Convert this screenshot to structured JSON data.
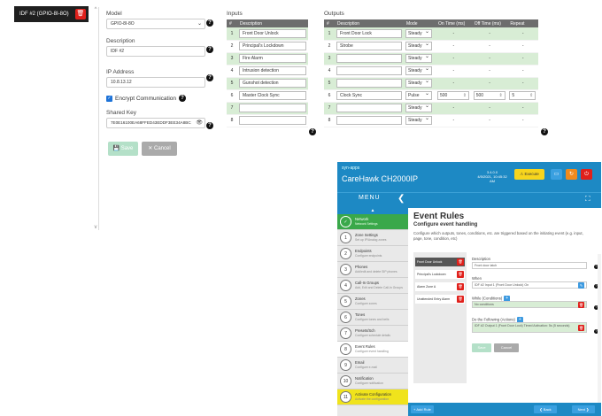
{
  "device_list": {
    "selected": "IDF #2 (GPIO-8I-8O)"
  },
  "form": {
    "model_label": "Model",
    "model_value": "GPIO-8I-8O",
    "description_label": "Description",
    "description_value": "IDF #2",
    "ip_label": "IP Address",
    "ip_value": "10.8.13.12",
    "encrypt_label": "Encrypt Communication",
    "shared_key_label": "Shared Key",
    "shared_key_value": "7E0E16100EA68FFED43EDDF3EE34A8BC",
    "save_label": "Save",
    "cancel_label": "Cancel"
  },
  "inputs": {
    "title": "Inputs",
    "headers": [
      "#",
      "Description"
    ],
    "rows": [
      {
        "n": "1",
        "d": "Front Door Unlock"
      },
      {
        "n": "2",
        "d": "Principal's Lockdown"
      },
      {
        "n": "3",
        "d": "Fire Alarm"
      },
      {
        "n": "4",
        "d": "Intrusion detection"
      },
      {
        "n": "5",
        "d": "Gunshot detection"
      },
      {
        "n": "6",
        "d": "Master Clock Sync"
      },
      {
        "n": "7",
        "d": ""
      },
      {
        "n": "8",
        "d": ""
      }
    ]
  },
  "outputs": {
    "title": "Outputs",
    "headers": [
      "#",
      "Description",
      "Mode",
      "On Time (ms)",
      "Off Time (ms)",
      "Repeat"
    ],
    "rows": [
      {
        "n": "1",
        "d": "Front Door Lock",
        "m": "Steady",
        "on": "-",
        "off": "-",
        "r": "-"
      },
      {
        "n": "2",
        "d": "Strobe",
        "m": "Steady",
        "on": "-",
        "off": "-",
        "r": "-"
      },
      {
        "n": "3",
        "d": "",
        "m": "Steady",
        "on": "-",
        "off": "-",
        "r": "-"
      },
      {
        "n": "4",
        "d": "",
        "m": "Steady",
        "on": "-",
        "off": "-",
        "r": "-"
      },
      {
        "n": "5",
        "d": "",
        "m": "Steady",
        "on": "-",
        "off": "-",
        "r": "-"
      },
      {
        "n": "6",
        "d": "Clock Sync",
        "m": "Pulse",
        "on": "500",
        "off": "500",
        "r": "5"
      },
      {
        "n": "7",
        "d": "",
        "m": "Steady",
        "on": "-",
        "off": "-",
        "r": "-"
      },
      {
        "n": "8",
        "d": "",
        "m": "Steady",
        "on": "-",
        "off": "-",
        "r": "-"
      }
    ]
  },
  "app": {
    "logo_text": "syn-apps",
    "product_name": "CareHawk CH2000IP",
    "version": "3.4.0.0",
    "datetime": "4/5/2021, 10:45:32 AM",
    "alarm_label": "Execute",
    "menu_label": "MENU",
    "side_items": [
      {
        "n": "✓",
        "t": "Network",
        "s": "Network Settings"
      },
      {
        "n": "1",
        "t": "Zone Settings",
        "s": "Set up IP/Analog zones"
      },
      {
        "n": "2",
        "t": "Endpoints",
        "s": "Configure endpoints"
      },
      {
        "n": "3",
        "t": "Phones",
        "s": "Add/edit and delete SIP phones"
      },
      {
        "n": "4",
        "t": "Call-In Groups",
        "s": "Add, Edit and Delete Call-In Groups"
      },
      {
        "n": "5",
        "t": "Zones",
        "s": "Configure zones"
      },
      {
        "n": "6",
        "t": "Tones",
        "s": "Configure tones and bells"
      },
      {
        "n": "7",
        "t": "Presets/Sch",
        "s": "Configure schedule details"
      },
      {
        "n": "8",
        "t": "Event Rules",
        "s": "Configure event handling"
      },
      {
        "n": "9",
        "t": "Email",
        "s": "Configure e-mail"
      },
      {
        "n": "10",
        "t": "Notification",
        "s": "Configure notification"
      },
      {
        "n": "11",
        "t": "Activate Configuration",
        "s": "Activate the configuration"
      }
    ],
    "title": "Event Rules",
    "subtitle": "Configure event handling",
    "desc": "Configure which outputs, tones, conditions, etc. are triggered based on the initiating event (e.g. input, page, tone, condition, etc)",
    "rules": [
      "Front Door Unlock",
      "Principal's Lockdown",
      "Alarm Zone A",
      "Unattended Entry Alarm"
    ],
    "rule_form": {
      "description_label": "Description",
      "description_value": "Front door latch",
      "when_label": "When",
      "when_value": "IDF #2 Input 1 (Front Door Unlock) On",
      "while_label": "While (Conditions)",
      "while_value": "No conditions",
      "do_label": "Do the Following (Actions)",
      "do_value": "IDF #2 Output 1 (Front Door Lock) Timed Activation: 5s (5 seconds)",
      "save_label": "Save",
      "cancel_label": "Cancel"
    },
    "add_rule_label": "+ Add Rule",
    "back_label": "❮ Back",
    "next_label": "Next ❯"
  }
}
